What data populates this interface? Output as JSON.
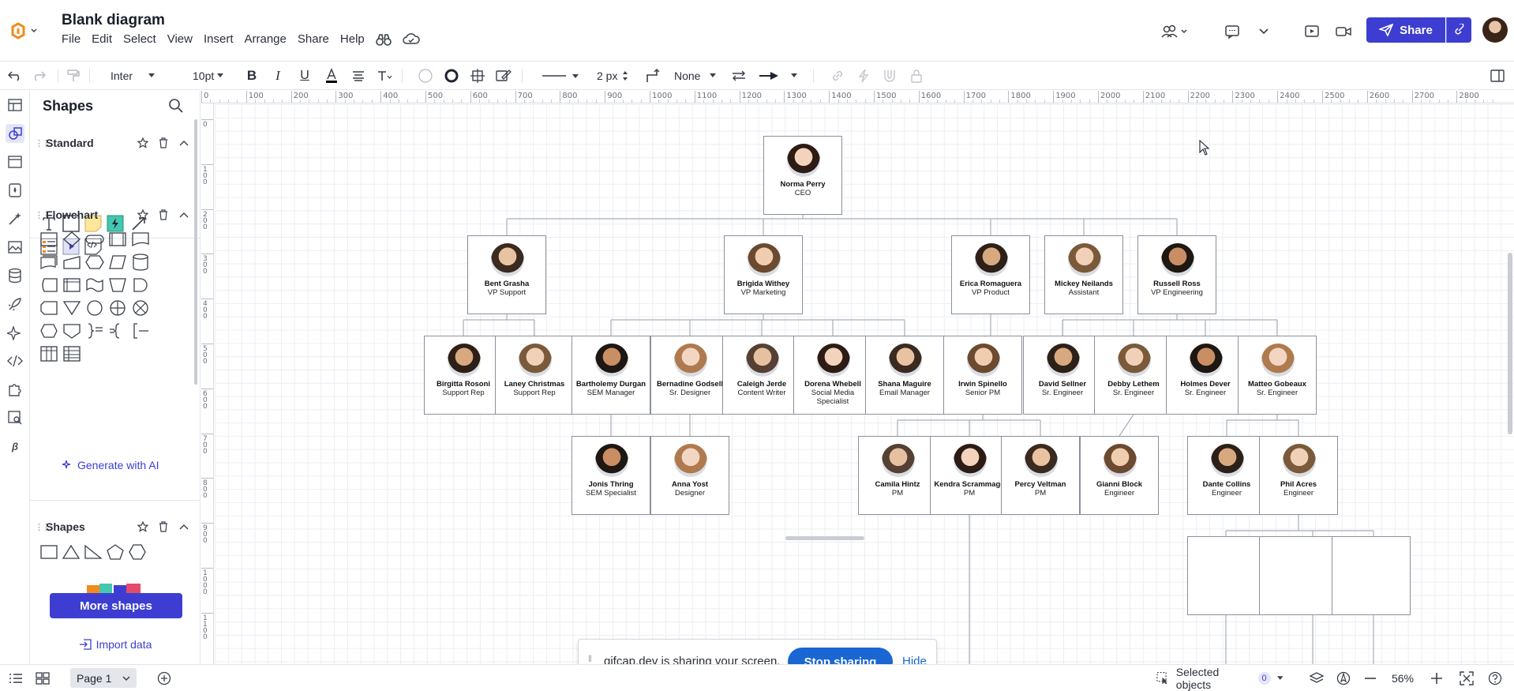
{
  "app": {
    "title": "Blank diagram",
    "menu": [
      "File",
      "Edit",
      "Select",
      "View",
      "Insert",
      "Arrange",
      "Share",
      "Help"
    ],
    "share_label": "Share",
    "accent": "#3d3ed1"
  },
  "toolbar": {
    "font": "Inter",
    "font_size": "10pt",
    "line_width": "2 px",
    "endpoint": "None"
  },
  "ruler": {
    "h_ticks": [
      "0",
      "100",
      "200",
      "300",
      "400",
      "500",
      "600",
      "700",
      "800",
      "900",
      "1000",
      "1100",
      "1200",
      "1300",
      "1400",
      "1500",
      "1600",
      "1700",
      "1800",
      "1900",
      "2000",
      "2100",
      "2200",
      "2300",
      "2400",
      "2500",
      "2600",
      "2700",
      "2800"
    ],
    "v_ticks": [
      "0",
      "100",
      "200",
      "300",
      "400",
      "500",
      "600",
      "700",
      "800",
      "900",
      "1000",
      "1100"
    ]
  },
  "panel": {
    "title": "Shapes",
    "libraries": [
      {
        "name": "Standard"
      },
      {
        "name": "Flowchart"
      },
      {
        "name": "Shapes"
      }
    ],
    "generate_ai": "Generate with AI",
    "more_shapes": "More shapes",
    "import_data": "Import data"
  },
  "org": {
    "ceo": {
      "name": "Norma Perry",
      "role": "CEO"
    },
    "vps": [
      {
        "name": "Bent Grasha",
        "role": "VP Support"
      },
      {
        "name": "Brigida Withey",
        "role": "VP Marketing"
      },
      {
        "name": "Erica Romaguera",
        "role": "VP Product"
      },
      {
        "name": "Mickey Neilands",
        "role": "Assistant"
      },
      {
        "name": "Russell Ross",
        "role": "VP Engineering"
      }
    ],
    "level3": [
      {
        "name": "Birgitta Rosoni",
        "role": "Support Rep"
      },
      {
        "name": "Laney Christmas",
        "role": "Support Rep"
      },
      {
        "name": "Bartholemy Durgan",
        "role": "SEM Manager"
      },
      {
        "name": "Bernadine Godsell",
        "role": "Sr. Designer"
      },
      {
        "name": "Caleigh Jerde",
        "role": "Content Writer"
      },
      {
        "name": "Dorena Whebell",
        "role": "Social Media Specialist"
      },
      {
        "name": "Shana Maguire",
        "role": "Email Manager"
      },
      {
        "name": "Irwin Spinello",
        "role": "Senior PM"
      },
      {
        "name": "David Sellner",
        "role": "Sr. Engineer"
      },
      {
        "name": "Debby Lethem",
        "role": "Sr. Engineer"
      },
      {
        "name": "Holmes Dever",
        "role": "Sr. Engineer"
      },
      {
        "name": "Matteo Gobeaux",
        "role": "Sr. Engineer"
      }
    ],
    "level4": [
      {
        "name": "Jonis Thring",
        "role": "SEM Specialist"
      },
      {
        "name": "Anna Yost",
        "role": "Designer"
      },
      {
        "name": "Camila Hintz",
        "role": "PM"
      },
      {
        "name": "Kendra Scrammage",
        "role": "PM"
      },
      {
        "name": "Percy Veltman",
        "role": "PM"
      },
      {
        "name": "Gianni Block",
        "role": "Engineer"
      },
      {
        "name": "Dante Collins",
        "role": "Engineer"
      },
      {
        "name": "Phil Acres",
        "role": "Engineer"
      }
    ]
  },
  "screen_share": {
    "message": "gifcap.dev is sharing your screen.",
    "stop_label": "Stop sharing",
    "hide_label": "Hide"
  },
  "bottom": {
    "page_label": "Page 1",
    "selected_label": "Selected objects",
    "selected_count": "0",
    "zoom": "56%"
  }
}
